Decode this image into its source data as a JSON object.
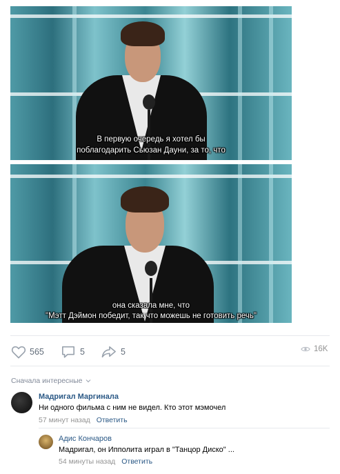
{
  "frames": [
    {
      "subtitle_line1": "В первую очередь я хотел бы",
      "subtitle_line2": "поблагодарить Сьюзан Дауни, за то, что"
    },
    {
      "subtitle_line1": "она сказала мне, что",
      "subtitle_line2": "\"Мэтт Дэймон победит, так что можешь не готовить речь\""
    }
  ],
  "actions": {
    "likes_icon": "heart-icon",
    "likes_count": "565",
    "comments_icon": "comment-icon",
    "comments_count": "5",
    "shares_icon": "share-icon",
    "shares_count": "5",
    "views_icon": "eye-icon",
    "views_count": "16K"
  },
  "comments_sort": {
    "label": "Сначала интересные",
    "icon": "chevron-down-icon"
  },
  "comments": [
    {
      "author": "Мадригал Маргинала",
      "text": "Ни одного фильма с ним не видел. Кто этот мэмочел",
      "time": "57 минут назад",
      "reply": "Ответить"
    },
    {
      "author": "Адис Кончаров",
      "text": "Мадригал, он Ипполита играл в \"Танцор Диско\" ...",
      "time": "54 минуты назад",
      "reply": "Ответить"
    }
  ],
  "colors": {
    "link": "#2a5885",
    "muted": "#828a99",
    "icon": "#99a2ad"
  }
}
